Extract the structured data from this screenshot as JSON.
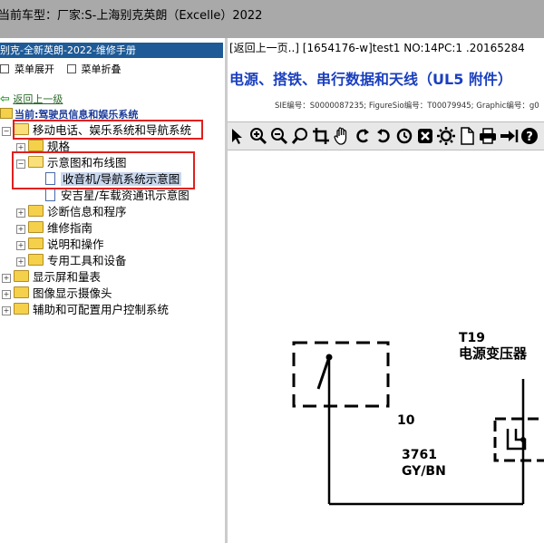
{
  "window": {
    "title": "当前车型：厂家:S-上海别克英朗（Excelle）2022"
  },
  "left_pane": {
    "header": "别克-全新英朗-2022-维修手册",
    "menu_expand": "菜单展开",
    "menu_collapse": "菜单折叠",
    "back_link": "返回上一级",
    "current": "当前:驾驶员信息和娱乐系统",
    "tree": [
      {
        "label": "移动电话、娱乐系统和导航系统",
        "toggle": "−"
      },
      {
        "label": "规格",
        "toggle": "+"
      },
      {
        "label": "示意图和布线图",
        "toggle": "−"
      },
      {
        "label": "收音机/导航系统示意图",
        "selected": true
      },
      {
        "label": "安吉星/车载资通讯示意图"
      },
      {
        "label": "诊断信息和程序",
        "toggle": "+"
      },
      {
        "label": "维修指南",
        "toggle": "+"
      },
      {
        "label": "说明和操作",
        "toggle": "+"
      },
      {
        "label": "专用工具和设备",
        "toggle": "+"
      },
      {
        "label": "显示屏和量表",
        "toggle": "+"
      },
      {
        "label": "图像显示摄像头",
        "toggle": "+"
      },
      {
        "label": "辅助和可配置用户控制系统",
        "toggle": "+"
      }
    ]
  },
  "right_pane": {
    "header": "[返回上一页..] [1654176-w]test1 NO:14PC:1 .20165284",
    "title": "电源、搭铁、串行数据和天线（UL5 附件）",
    "sie": "SIE编号：S0000087235;  FigureSio编号：T00079945;  Graphic编号：g0",
    "toolbar_icons": [
      "pointer-icon",
      "zoom-in-icon",
      "zoom-out-icon",
      "magnifier-icon",
      "crop-icon",
      "hand-pan-icon",
      "rotate-left-icon",
      "rotate-right-icon",
      "reset-icon",
      "fit-icon",
      "settings-icon",
      "page-icon",
      "print-icon",
      "export-icon",
      "help-icon"
    ],
    "diagram": {
      "component_id": "T19",
      "component_name": "电源变压器",
      "pin": "10",
      "circuit": "3761",
      "wire_color": "GY/BN"
    }
  },
  "colors": {
    "titlebar": "#a9a9a9",
    "header_blue": "#1e5a96",
    "title_blue": "#1a3fbf",
    "highlight_red": "#e02020"
  }
}
